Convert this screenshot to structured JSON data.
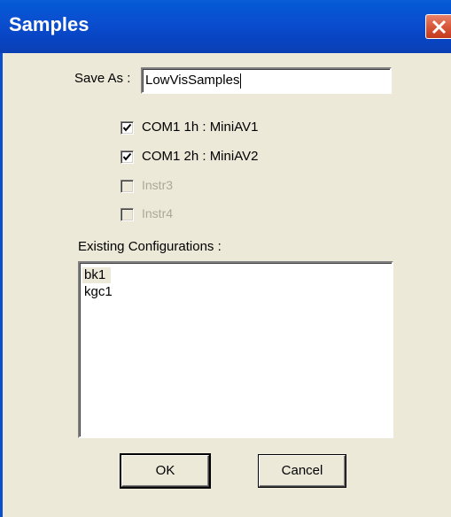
{
  "window": {
    "title": "Samples"
  },
  "form": {
    "save_as_label": "Save As :",
    "save_as_value": "LowVisSamples"
  },
  "instruments": [
    {
      "label": "COM1 1h : MiniAV1",
      "checked": true,
      "enabled": true
    },
    {
      "label": "COM1 2h : MiniAV2",
      "checked": true,
      "enabled": true
    },
    {
      "label": "Instr3",
      "checked": false,
      "enabled": false
    },
    {
      "label": "Instr4",
      "checked": false,
      "enabled": false
    }
  ],
  "configurations": {
    "label": "Existing Configurations :",
    "items": [
      "bk1",
      "kgc1"
    ],
    "selected": "bk1"
  },
  "buttons": {
    "ok_label": "OK",
    "cancel_label": "Cancel"
  },
  "colors": {
    "titlebar": "#0a4fd0",
    "dialog_bg": "#ece9d8",
    "close_button": "#d8583a",
    "disabled_text": "#aca899"
  }
}
